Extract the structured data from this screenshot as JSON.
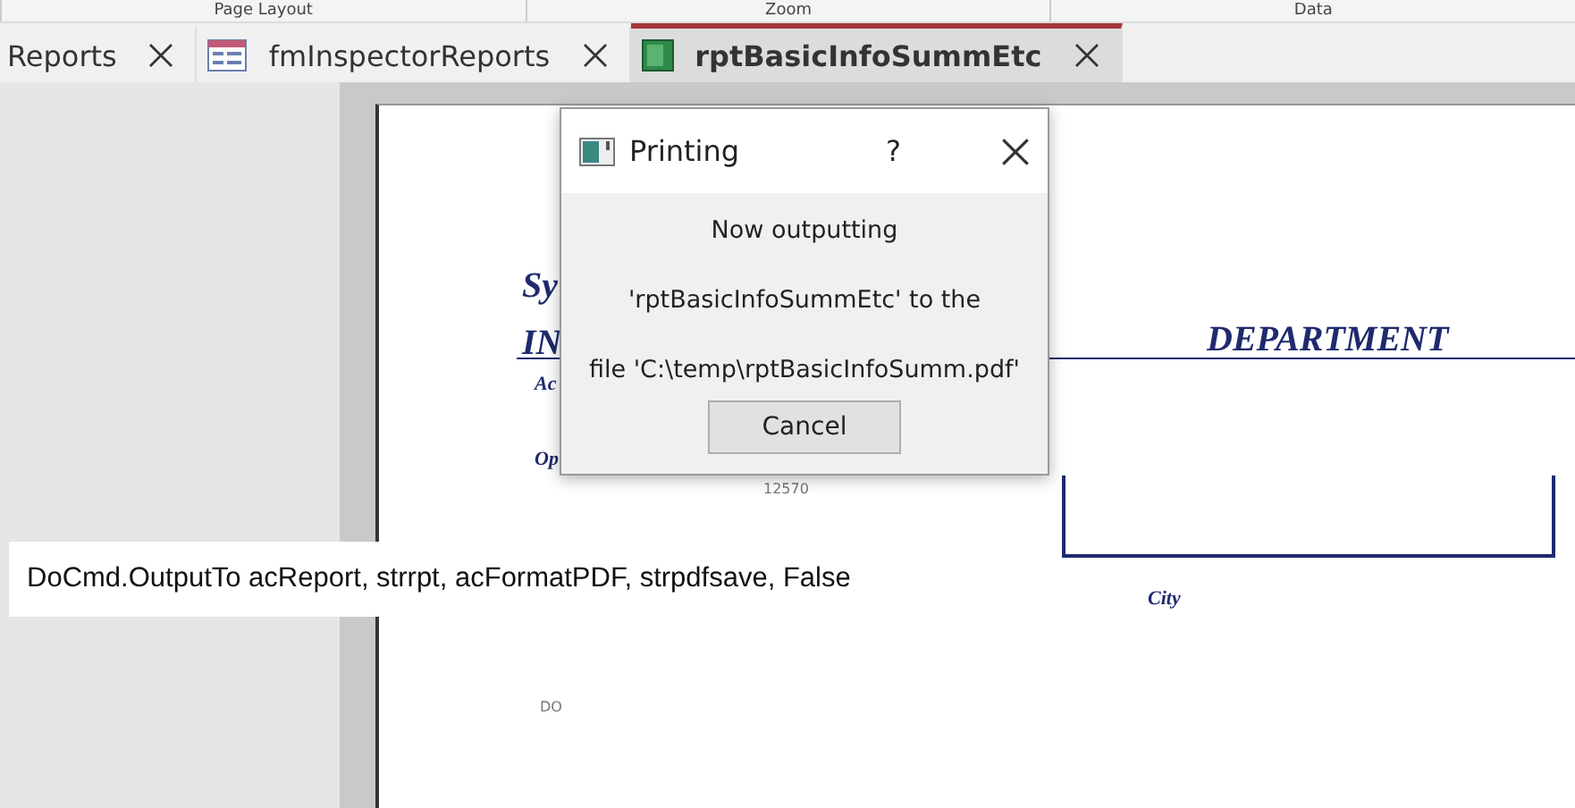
{
  "ribbon_groups": [
    "Page Layout",
    "Zoom",
    "Data"
  ],
  "tabs": [
    {
      "label": "Reports",
      "selected": false,
      "kind": "plain"
    },
    {
      "label": "fmInspectorReports",
      "selected": false,
      "kind": "form"
    },
    {
      "label": "rptBasicInfoSummEtc",
      "selected": true,
      "kind": "report"
    }
  ],
  "report_page": {
    "texts": [
      {
        "text": "Sy",
        "kind": "title"
      },
      {
        "text": "IN",
        "kind": "title"
      },
      {
        "text": "DEPARTMENT",
        "kind": "title"
      },
      {
        "text": "Ac",
        "kind": "label"
      },
      {
        "text": "Op",
        "kind": "label"
      },
      {
        "text": "12570",
        "kind": "small"
      },
      {
        "text": "City",
        "kind": "label"
      },
      {
        "text": "DO",
        "kind": "small"
      }
    ]
  },
  "dialog": {
    "title": "Printing",
    "help": "?",
    "message_lines": [
      "Now outputting",
      "'rptBasicInfoSummEtc' to the",
      "file 'C:\\temp\\rptBasicInfoSumm.pdf'"
    ],
    "button": "Cancel"
  },
  "code_note": "DoCmd.OutputTo acReport, strrpt, acFormatPDF, strpdfsave, False"
}
